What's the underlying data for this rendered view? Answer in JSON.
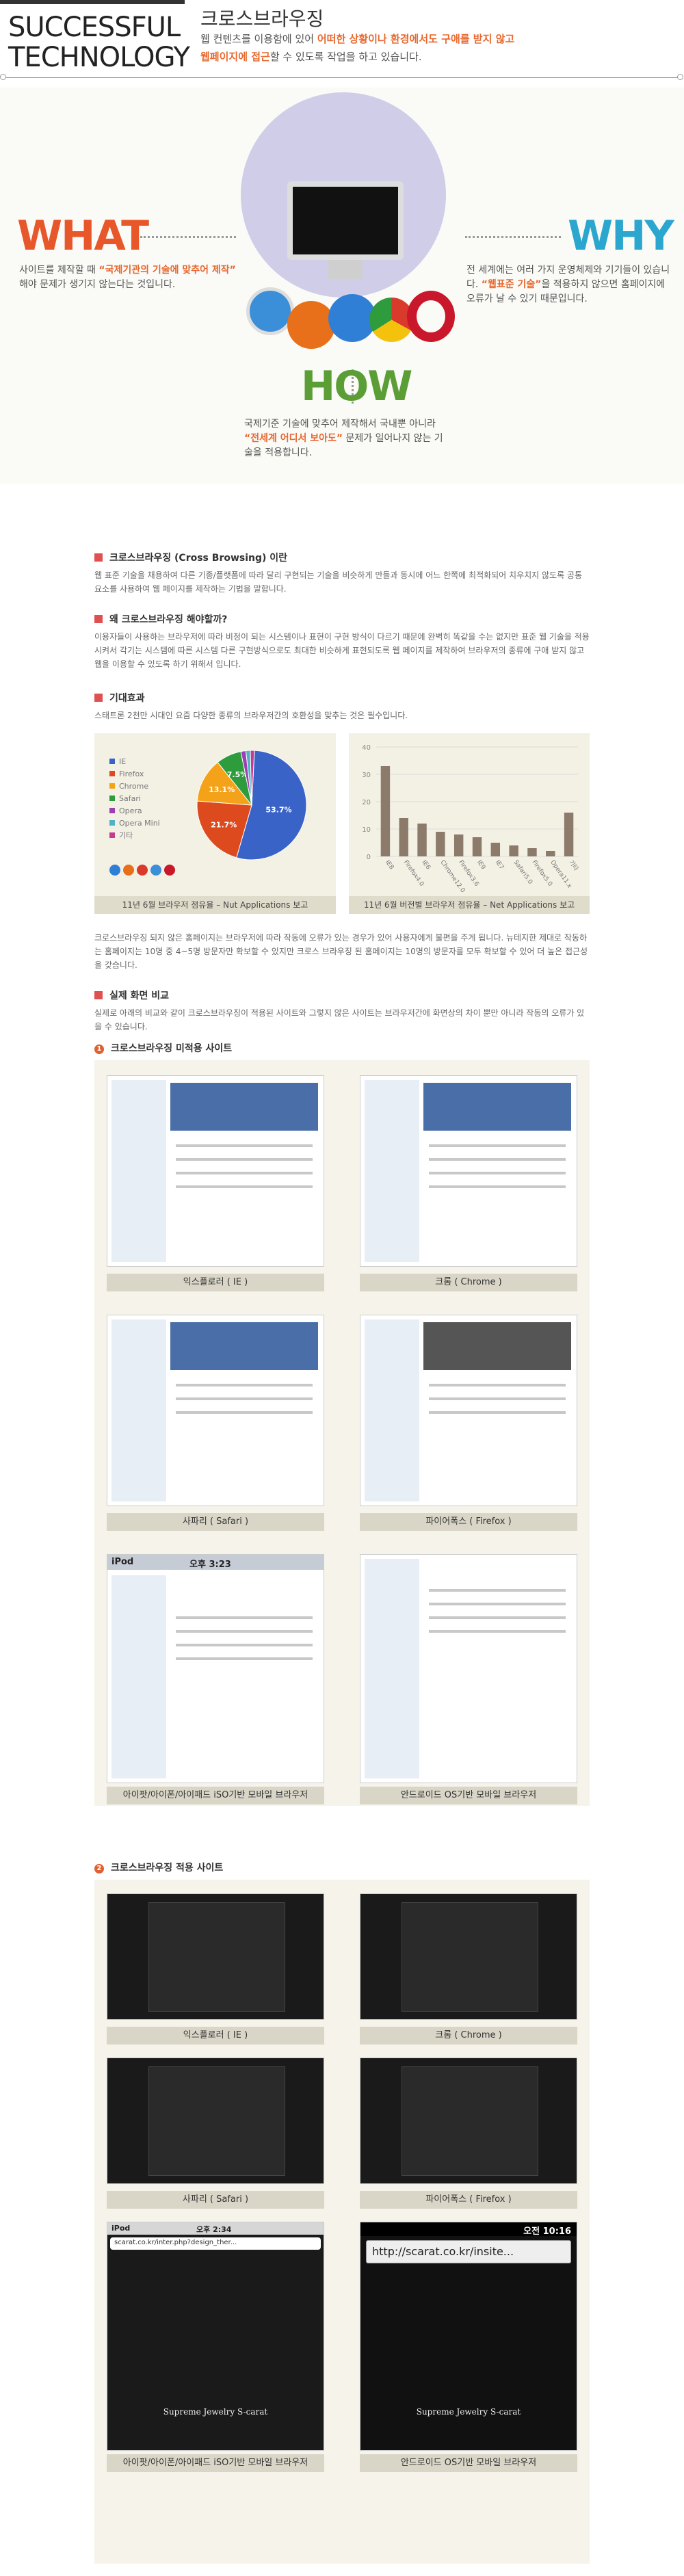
{
  "header": {
    "brand_line1": "SUCCESSFUL",
    "brand_line2": "TECHNOLOGY",
    "title": "크로스브라우징",
    "desc_part1": "웹 컨텐츠를 이용함에 있어 ",
    "desc_hl1": "어떠한 상황이나 환경에서도 구애를 받지 않고",
    "desc_hl2": "웹페이지에 접근",
    "desc_part2": "할 수 있도록 작업을 하고 있습니다."
  },
  "hero": {
    "what_word": "WHAT",
    "why_word": "WHY",
    "how_word": "HOW",
    "what_text_pre": "사이트를 제작할 때 ",
    "what_text_hl": "“국제기관의 기술에 맞추어 제작”",
    "what_text_post": " 해야 문제가 생기지 않는다는 것입니다.",
    "why_text_pre": "전 세계에는 여러 가지 운영체제와 기기들이 있습니다. ",
    "why_text_hl": "“웹표준 기술”",
    "why_text_post": "을 적용하지 않으면 홈페이지에 오류가 날 수 있기 때문입니다.",
    "how_text_pre": "국제기준 기술에 맞추어 제작해서 국내뿐 아니라 ",
    "how_text_hl": "“전세계 어디서 보아도”",
    "how_text_post": " 문제가 일어나지 않는 기술을 적용합니다."
  },
  "sections": {
    "s1_head": "크로스브라우징 (Cross Browsing) 이란",
    "s1_body": "웹 표준 기술을 채용하여 다른 기종/플랫폼에 따라 달리 구현되는 기술을 비슷하게 만들과 동시에 어느 한쪽에 최적화되어 치우치지 않도록 공통요소를 사용하여 웹 페이지를 제작하는 기법을 말합니다.",
    "s2_head": "왜 크로스브라우징 해야할까?",
    "s2_body": "이용자들이 사용하는 브라우저에 따라 비정이 되는 시스템이나 표현이 구현 방식이 다르기 때문에 완벽히 똑같을 수는 없지만 표준 웹 기술을 적용시켜서 각기는 시스템에 따른 시스템 다른 구현방식으로도 최대한 비슷하게 표현되도록 웹 페이지를 제작하여 브라우저의 종류에 구애 받지 않고 웹을 이용할 수 있도록 하기 위해서 입니다.",
    "s3_head": "기대효과",
    "s3_body": "스태트론 2천만 시대인 요즘 다양한 종류의 브라우저간의 호환성을 맞추는 것은 필수입니다.",
    "s3_after": "크로스브라우징 되지 않은 홈페이지는 브라우저에 따라 작동에 오류가 있는 경우가 있어 사용자에게 불편을 주게 됩니다. 뉴테지한 제대로 작동하는 홈페이지는 10명 중 4~5명 방문자만 확보할 수 있지만 크로스 브라우징 된 홈페이지는 10명의 방문자를 모두 확보할 수 있어 더 높은 접근성을 갖습니다.",
    "s4_head": "실제 화면 비교",
    "s4_body": "실제로 아래의 비교와 같이 크로스브라우징이 적용된 사이트와 그렇지 않은 사이트는 브라우저간에 화면상의 차이 뿐만 아니라 작동의 오류가 있을 수 있습니다.",
    "sub1_head": "크로스브라우징 미적용 사이트",
    "sub2_head": "크로스브라우징 적용 사이트"
  },
  "chart_captions": {
    "left": "11년 6월 브라우저 점유율 – Nut Applications 보고",
    "right": "11년 6월 버전별 브라우저 점유율 – Net Applications 보고"
  },
  "chart_data": [
    {
      "type": "pie",
      "categories": [
        "IE",
        "Firefox",
        "Chrome",
        "Safari",
        "Opera",
        "Opera Mini",
        "기타"
      ],
      "values": [
        53.7,
        21.7,
        13.1,
        7.5,
        1.5,
        1.3,
        1.2
      ],
      "slice_labels": [
        "53.7%",
        "21.7%",
        "13.1%",
        "7.5%"
      ],
      "colors": [
        "#3a63c8",
        "#dc4a1e",
        "#f4a21a",
        "#2e9b3c",
        "#9b3fb5",
        "#4fb3c6",
        "#c83a8f"
      ],
      "title": "11년 6월 브라우저 점유율 – Nut Applications 보고",
      "legend": "left"
    },
    {
      "type": "bar",
      "categories": [
        "IE8",
        "Firefox4.0",
        "IE6",
        "Chrome12.0",
        "Firefox3.6",
        "IE9",
        "IE7",
        "Safari5.0",
        "Firefox5.0",
        "Opera11.x",
        "기타"
      ],
      "values": [
        33,
        14,
        12,
        9,
        8,
        7,
        5,
        4,
        3,
        2,
        16
      ],
      "ylim": [
        0,
        40
      ],
      "ticks": [
        "40",
        "30",
        "20",
        "10",
        "0"
      ],
      "title": "11년 6월 버전별 브라우저 점유율 – Net Applications 보고",
      "grid": true,
      "color": "#8c7a6a"
    }
  ],
  "shots_unapplied": [
    {
      "caption": "익스플로러 ( IE )"
    },
    {
      "caption": "크롬 ( Chrome )"
    },
    {
      "caption": "사파리 ( Safari )"
    },
    {
      "caption": "파이어폭스 ( Firefox )"
    },
    {
      "caption": "아이팟/아이폰/아이패드 iSO기반 모바일 브라우저",
      "status": "iPod",
      "time": "오후 3:23"
    },
    {
      "caption": "안드로이드 OS기반 모바일 브라우저"
    }
  ],
  "shots_applied": [
    {
      "caption": "익스플로러 ( IE )"
    },
    {
      "caption": "크롬 ( Chrome )"
    },
    {
      "caption": "사파리 ( Safari )"
    },
    {
      "caption": "파이어폭스 ( Firefox )"
    },
    {
      "caption": "아이팟/아이폰/아이패드 iSO기반 모바일 브라우저",
      "status": "iPod",
      "time": "오후 2:34",
      "url": "scarat.co.kr/inter.php?design_ther...",
      "brand": "Supreme Jewelry S-carat"
    },
    {
      "caption": "안드로이드 OS기반 모바일 브라우저",
      "time": "오전 10:16",
      "url": "http://scarat.co.kr/insite...",
      "brand": "Supreme Jewelry S-carat"
    }
  ]
}
